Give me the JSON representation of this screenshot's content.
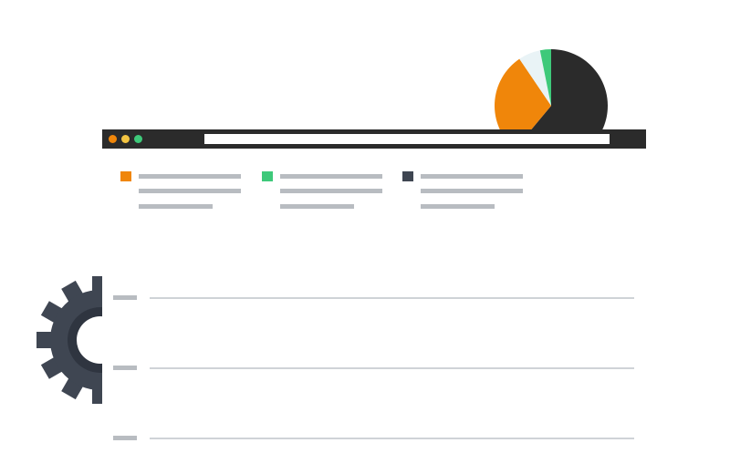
{
  "icons": {
    "gear": "gear-icon",
    "pie": "pie-chart-icon"
  },
  "colors": {
    "orange": "#f0860a",
    "green": "#3ec97a",
    "dark": "#2b2b2b",
    "navy": "#3f4652",
    "gray_line": "#b8bcc1",
    "light_line": "#cfd3d7"
  },
  "browser": {
    "dots": [
      "orange",
      "yellow",
      "green"
    ],
    "address_value": ""
  },
  "legend": [
    {
      "color": "#f0860a"
    },
    {
      "color": "#3ec97a"
    },
    {
      "color": "#3f4652"
    }
  ],
  "rows_count": 3,
  "chart_data": {
    "type": "pie",
    "values": [
      58,
      28,
      6,
      3
    ],
    "colors": [
      "#2b2b2b",
      "#f0860a",
      "#e9f3f6",
      "#3ec97a"
    ]
  }
}
